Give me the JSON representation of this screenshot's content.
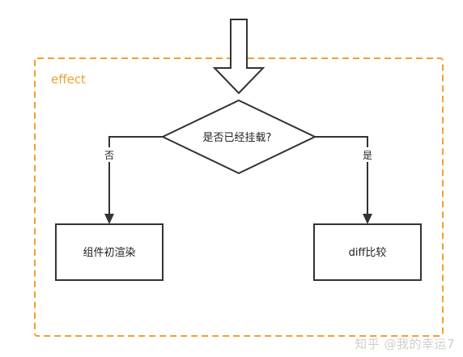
{
  "diagram": {
    "container_label": "effect",
    "decision": "是否已经挂载?",
    "branch_no": "否",
    "branch_yes": "是",
    "box_left": "组件初渲染",
    "box_right": "diff比较"
  },
  "watermark": "知乎 @我的幸运7",
  "colors": {
    "accent": "#f0a030",
    "line": "#333333"
  }
}
